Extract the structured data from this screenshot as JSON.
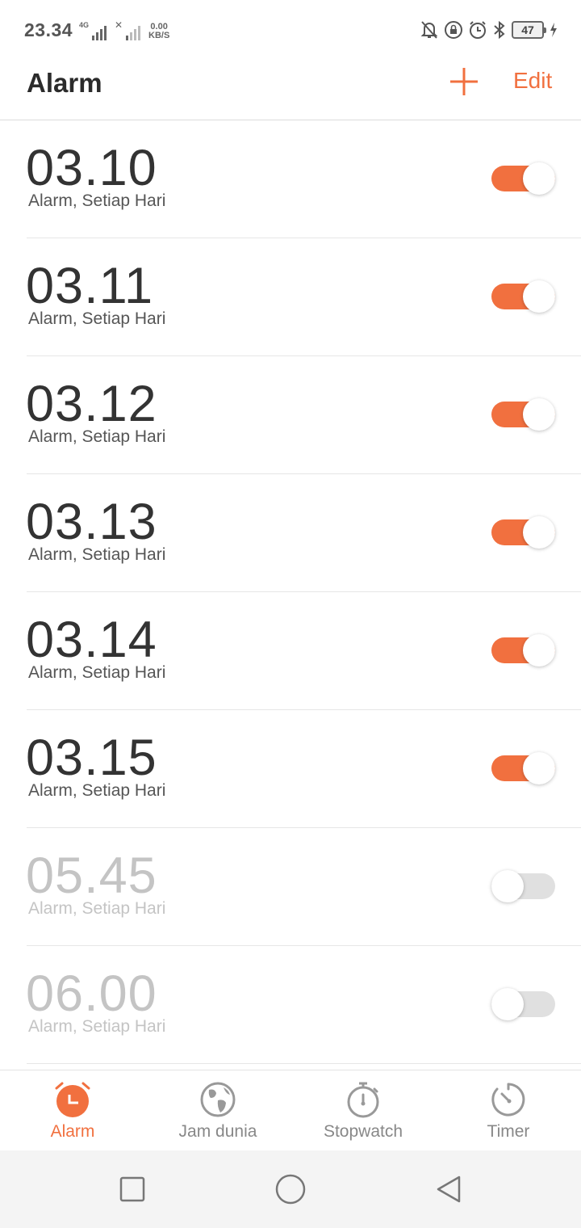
{
  "status_bar": {
    "time": "23.34",
    "sim1_type": "4G",
    "net_speed_value": "0.00",
    "net_speed_unit": "KB/S",
    "battery_level": "47"
  },
  "header": {
    "title": "Alarm",
    "add_icon": "plus-icon",
    "edit_label": "Edit"
  },
  "alarms": [
    {
      "time": "03.10",
      "label": "Alarm, Setiap Hari",
      "enabled": true
    },
    {
      "time": "03.11",
      "label": "Alarm, Setiap Hari",
      "enabled": true
    },
    {
      "time": "03.12",
      "label": "Alarm, Setiap Hari",
      "enabled": true
    },
    {
      "time": "03.13",
      "label": "Alarm, Setiap Hari",
      "enabled": true
    },
    {
      "time": "03.14",
      "label": "Alarm, Setiap Hari",
      "enabled": true
    },
    {
      "time": "03.15",
      "label": "Alarm, Setiap Hari",
      "enabled": true
    },
    {
      "time": "05.45",
      "label": "Alarm, Setiap Hari",
      "enabled": false
    },
    {
      "time": "06.00",
      "label": "Alarm, Setiap Hari",
      "enabled": false
    }
  ],
  "bottom_nav": {
    "tabs": [
      {
        "label": "Alarm",
        "icon": "alarm-clock-icon",
        "active": true
      },
      {
        "label": "Jam dunia",
        "icon": "globe-icon",
        "active": false
      },
      {
        "label": "Stopwatch",
        "icon": "stopwatch-icon",
        "active": false
      },
      {
        "label": "Timer",
        "icon": "timer-icon",
        "active": false
      }
    ]
  },
  "colors": {
    "accent": "#f1703f",
    "toggle_off": "#e0e0e0",
    "text_primary": "#333333",
    "text_disabled": "#c4c4c4"
  }
}
